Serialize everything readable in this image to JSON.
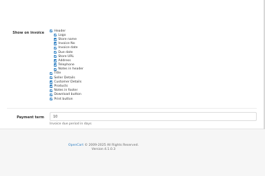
{
  "form": {
    "show_on_invoice_label": "Show on invoice",
    "checkboxes": [
      {
        "label": "Header",
        "level": 0,
        "checked": true
      },
      {
        "label": "Logo",
        "level": 1,
        "checked": true
      },
      {
        "label": "Store name",
        "level": 1,
        "checked": true
      },
      {
        "label": "Invoice No",
        "level": 1,
        "checked": true
      },
      {
        "label": "Invoice date",
        "level": 1,
        "checked": true
      },
      {
        "label": "Due date",
        "level": 1,
        "checked": true
      },
      {
        "label": "Store URL",
        "level": 1,
        "checked": true
      },
      {
        "label": "Address",
        "level": 1,
        "checked": true
      },
      {
        "label": "Telephone",
        "level": 1,
        "checked": true
      },
      {
        "label": "Notes in header",
        "level": 1,
        "checked": true
      },
      {
        "label": "Title",
        "level": 0,
        "checked": true
      },
      {
        "label": "Seller Details",
        "level": 0,
        "checked": true
      },
      {
        "label": "Customer Details",
        "level": 0,
        "checked": true
      },
      {
        "label": "Products",
        "level": 0,
        "checked": true
      },
      {
        "label": "Notes in footer",
        "level": 0,
        "checked": true
      },
      {
        "label": "Download button",
        "level": 0,
        "checked": true
      },
      {
        "label": "Print button",
        "level": 0,
        "checked": true
      }
    ],
    "payment_term_label": "Payment term",
    "payment_term_value": "10",
    "payment_term_help": "Invoice due period in days"
  },
  "footer": {
    "brand_link": "OpenCart",
    "copyright": " © 2009-2025 All Rights Reserved.",
    "version": "Version 4.1.0.3"
  },
  "colors": {
    "accent": "#2b7dc1"
  }
}
